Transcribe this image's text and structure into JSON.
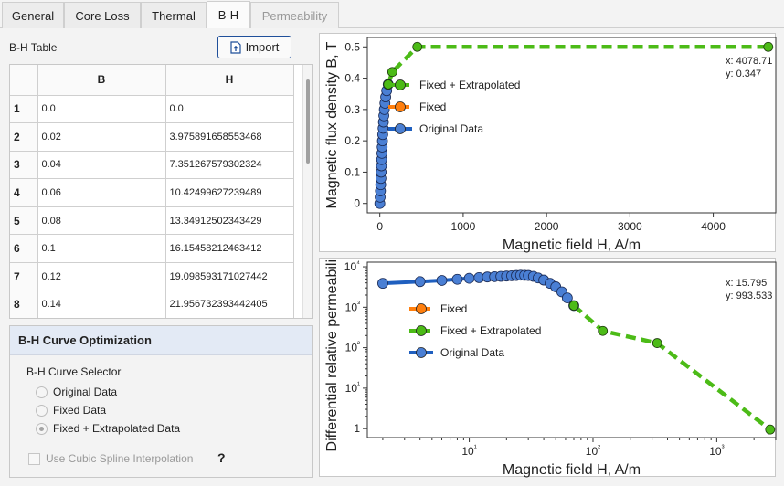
{
  "tabs": [
    {
      "label": "General",
      "state": "normal"
    },
    {
      "label": "Core Loss",
      "state": "normal"
    },
    {
      "label": "Thermal",
      "state": "normal"
    },
    {
      "label": "B-H",
      "state": "active"
    },
    {
      "label": "Permeability",
      "state": "disabled"
    }
  ],
  "table": {
    "label": "B-H Table",
    "import_label": "Import",
    "columns": [
      "B",
      "H"
    ],
    "rows": [
      {
        "index": "1",
        "b": "0.0",
        "h": "0.0"
      },
      {
        "index": "2",
        "b": "0.02",
        "h": "3.975891658553468"
      },
      {
        "index": "3",
        "b": "0.04",
        "h": "7.351267579302324"
      },
      {
        "index": "4",
        "b": "0.06",
        "h": "10.42499627239489"
      },
      {
        "index": "5",
        "b": "0.08",
        "h": "13.34912502343429"
      },
      {
        "index": "6",
        "b": "0.1",
        "h": "16.15458212463412"
      },
      {
        "index": "7",
        "b": "0.12",
        "h": "19.098593171027442"
      },
      {
        "index": "8",
        "b": "0.14",
        "h": "21.956732393442405"
      }
    ]
  },
  "optimization": {
    "title": "B-H Curve Optimization",
    "selector_label": "B-H Curve Selector",
    "options": [
      {
        "label": "Original Data",
        "checked": false
      },
      {
        "label": "Fixed Data",
        "checked": false
      },
      {
        "label": "Fixed + Extrapolated Data",
        "checked": true
      }
    ],
    "spline_label": "Use Cubic Spline Interpolation",
    "help": "?"
  },
  "colors": {
    "original": "#1f5fbf",
    "original_marker": "#4a7fd4",
    "fixed": "#ff7f0e",
    "extrapolated": "#4cbb17",
    "accent": "#1f4f9a"
  },
  "chart_data": [
    {
      "type": "line",
      "xlabel": "Magnetic field H, A/m",
      "ylabel": "Magnetic flux density B, T",
      "xlim": [
        -150,
        4750
      ],
      "ylim": [
        -0.03,
        0.53
      ],
      "xticks": [
        0,
        1000,
        2000,
        3000,
        4000
      ],
      "yticks": [
        0,
        0.1,
        0.2,
        0.3,
        0.4,
        0.5
      ],
      "readout": {
        "x": "4078.71",
        "y": "0.347"
      },
      "legend": [
        "Fixed + Extrapolated",
        "Fixed",
        "Original Data"
      ],
      "series": [
        {
          "name": "Original Data",
          "x": [
            0,
            4,
            7.35,
            10.4,
            13.3,
            16.2,
            19.1,
            22,
            25,
            28,
            31.5,
            35,
            39,
            43,
            48,
            54,
            61,
            70,
            82,
            100
          ],
          "y": [
            0,
            0.02,
            0.04,
            0.06,
            0.08,
            0.1,
            0.12,
            0.14,
            0.16,
            0.18,
            0.2,
            0.22,
            0.24,
            0.26,
            0.28,
            0.3,
            0.32,
            0.34,
            0.36,
            0.38
          ]
        },
        {
          "name": "Fixed",
          "x": [],
          "y": []
        },
        {
          "name": "Fixed + Extrapolated",
          "x": [
            100,
            150,
            450,
            4660
          ],
          "y": [
            0.38,
            0.42,
            0.5,
            0.5
          ]
        }
      ]
    },
    {
      "type": "line",
      "xlabel": "Magnetic field H, A/m",
      "ylabel": "Differential relative permeability",
      "xscale": "log",
      "yscale": "log",
      "xlim": [
        1.5,
        3000
      ],
      "ylim": [
        0.6,
        13000
      ],
      "xticks": [
        "10¹",
        "10²",
        "10³"
      ],
      "yticks": [
        "1",
        "10¹",
        "10²",
        "10³",
        "10⁴"
      ],
      "readout": {
        "x": "15.795",
        "y": "993.533"
      },
      "legend": [
        "Fixed",
        "Fixed + Extrapolated",
        "Original Data"
      ],
      "series": [
        {
          "name": "Original Data",
          "x": [
            2,
            4,
            6,
            8,
            10,
            12,
            14,
            16,
            18,
            20,
            22,
            24,
            26,
            28,
            30,
            33,
            36,
            40,
            45,
            50,
            56,
            62,
            70
          ],
          "y": [
            3900,
            4300,
            4600,
            4900,
            5200,
            5400,
            5600,
            5700,
            5800,
            5900,
            6000,
            6100,
            6200,
            6150,
            6100,
            5800,
            5300,
            4700,
            3900,
            3200,
            2400,
            1700,
            1100
          ]
        },
        {
          "name": "Fixed",
          "x": [],
          "y": []
        },
        {
          "name": "Fixed + Extrapolated",
          "x": [
            70,
            120,
            330,
            2700
          ],
          "y": [
            1100,
            260,
            130,
            0.95
          ]
        }
      ]
    }
  ]
}
